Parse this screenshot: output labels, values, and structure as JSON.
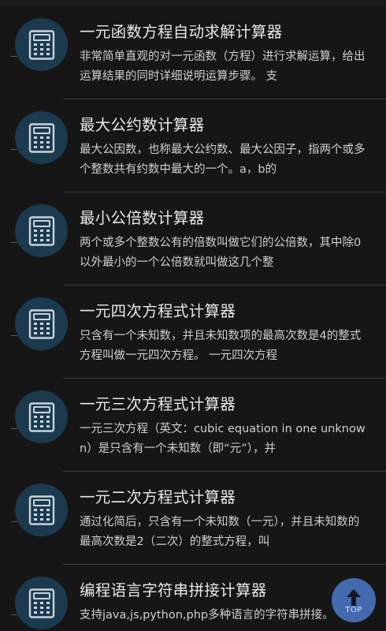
{
  "items": [
    {
      "title": "一元函数方程自动求解计算器",
      "desc": "非常简单直观的对一元函数（方程）进行求解运算，给出运算结果的同时详细说明运算步骤。 支"
    },
    {
      "title": "最大公约数计算器",
      "desc": "最大公因数，也称最大公约数、最大公因子，指两个或多个整数共有约数中最大的一个。a，b的"
    },
    {
      "title": "最小公倍数计算器",
      "desc": "两个或多个整数公有的倍数叫做它们的公倍数，其中除0以外最小的一个公倍数就叫做这几个整"
    },
    {
      "title": "一元四次方程式计算器",
      "desc": "只含有一个未知数，并且未知数项的最高次数是4的整式方程叫做一元四次方程。 一元四次方程"
    },
    {
      "title": "一元三次方程式计算器",
      "desc": "一元三次方程（英文：cubic equation in one unknown）是只含有一个未知数（即“元”），并"
    },
    {
      "title": "一元二次方程式计算器",
      "desc": "通过化简后，只含有一个未知数（一元），并且未知数的最高次数是2（二次）的整式方程，叫"
    },
    {
      "title": "编程语言字符串拼接计算器",
      "desc": "支持java,js,python,php多种语言的字符串拼接。"
    }
  ],
  "icon": "calculator-icon",
  "top_button": {
    "label": "TOP",
    "icon": "arrow-up-icon"
  },
  "colors": {
    "background": "#161616",
    "icon_circle": "#1c3a4e",
    "icon_glyph": "#c9d3dc",
    "top_button": "#4a76c4"
  }
}
